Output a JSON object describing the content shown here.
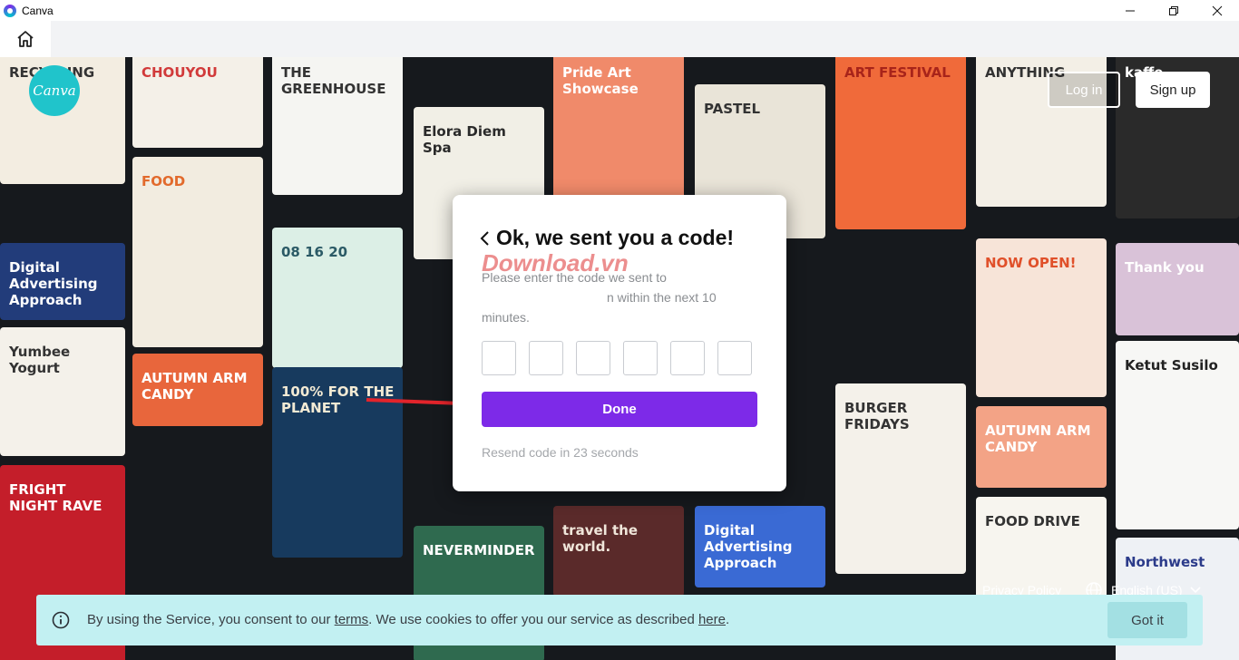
{
  "window": {
    "title": "Canva"
  },
  "header": {
    "login_label": "Log in",
    "signup_label": "Sign up",
    "logo_text": "Canva"
  },
  "modal": {
    "title": "Ok, we sent you a code!",
    "watermark": "Download.vn",
    "instruction_line1": "Please enter the code we sent to",
    "instruction_line2": "n within the next 10",
    "instruction_line3": "minutes.",
    "code_boxes": 6,
    "done_label": "Done",
    "resend_text": "Resend code in 23 seconds"
  },
  "footer": {
    "privacy_label": "Privacy Policy",
    "language_label": "English (US)"
  },
  "cookie": {
    "text_before": "By using the Service, you consent to our ",
    "terms_link": "terms",
    "text_middle": ". We use cookies to offer you our service as described ",
    "here_link": "here",
    "text_after": ".",
    "button_label": "Got it"
  },
  "background_tiles": [
    {
      "text": "RECYCLING",
      "bg": "#f3ede1",
      "fg": "#333333"
    },
    {
      "text": "CHOUYOU",
      "bg": "#f4f0e8",
      "fg": "#d13a3a"
    },
    {
      "text": "THE GREENHOUSE",
      "bg": "#f5f5f2",
      "fg": "#333333"
    },
    {
      "text": "Pride Art Showcase",
      "bg": "#f08a6a",
      "fg": "#ffffff"
    },
    {
      "text": "PASTEL",
      "bg": "#e9e4d8",
      "fg": "#333333"
    },
    {
      "text": "ART FESTIVAL",
      "bg": "#f06a3a",
      "fg": "#a8241a"
    },
    {
      "text": "ANYTHING",
      "bg": "#f3efe6",
      "fg": "#333333"
    },
    {
      "text": "kaffe",
      "bg": "#2a2a2a",
      "fg": "#ffffff"
    },
    {
      "text": "Elora Diem Spa",
      "bg": "#f1efe6",
      "fg": "#2a2a2a"
    },
    {
      "text": "FOOD",
      "bg": "#f2ece0",
      "fg": "#e26a2c"
    },
    {
      "text": "Digital Advertising Approach",
      "bg": "#223c7a",
      "fg": "#ffffff"
    },
    {
      "text": "08 16 20",
      "bg": "#dcefe6",
      "fg": "#2b5a66"
    },
    {
      "text": "NOW OPEN!",
      "bg": "#f7e4d8",
      "fg": "#e0502a"
    },
    {
      "text": "Thank you",
      "bg": "#d9c2d8",
      "fg": "#ffffff"
    },
    {
      "text": "Yumbee Yogurt",
      "bg": "#f4f1ea",
      "fg": "#333333"
    },
    {
      "text": "AUTUMN ARM CANDY",
      "bg": "#e8663c",
      "fg": "#ffffff"
    },
    {
      "text": "100% FOR THE PLANET",
      "bg": "#173a5e",
      "fg": "#f3ead4"
    },
    {
      "text": "BURGER FRIDAYS",
      "bg": "#f4f1ea",
      "fg": "#333333"
    },
    {
      "text": "Ketut Susilo",
      "bg": "#f7f7f5",
      "fg": "#222222"
    },
    {
      "text": "FRIGHT NIGHT RAVE",
      "bg": "#c41e2a",
      "fg": "#ffffff"
    },
    {
      "text": "NEVERMINDER",
      "bg": "#2f6a4f",
      "fg": "#ffffff"
    },
    {
      "text": "travel the world.",
      "bg": "#5a2a2a",
      "fg": "#f0e6da"
    },
    {
      "text": "Digital Advertising Approach",
      "bg": "#3a6ad4",
      "fg": "#ffffff"
    },
    {
      "text": "FOOD DRIVE",
      "bg": "#f7f5ef",
      "fg": "#333333"
    },
    {
      "text": "AUTUMN ARM CANDY",
      "bg": "#f3a386",
      "fg": "#ffffff"
    },
    {
      "text": "Northwest",
      "bg": "#eef1f5",
      "fg": "#2b3b8a"
    }
  ]
}
